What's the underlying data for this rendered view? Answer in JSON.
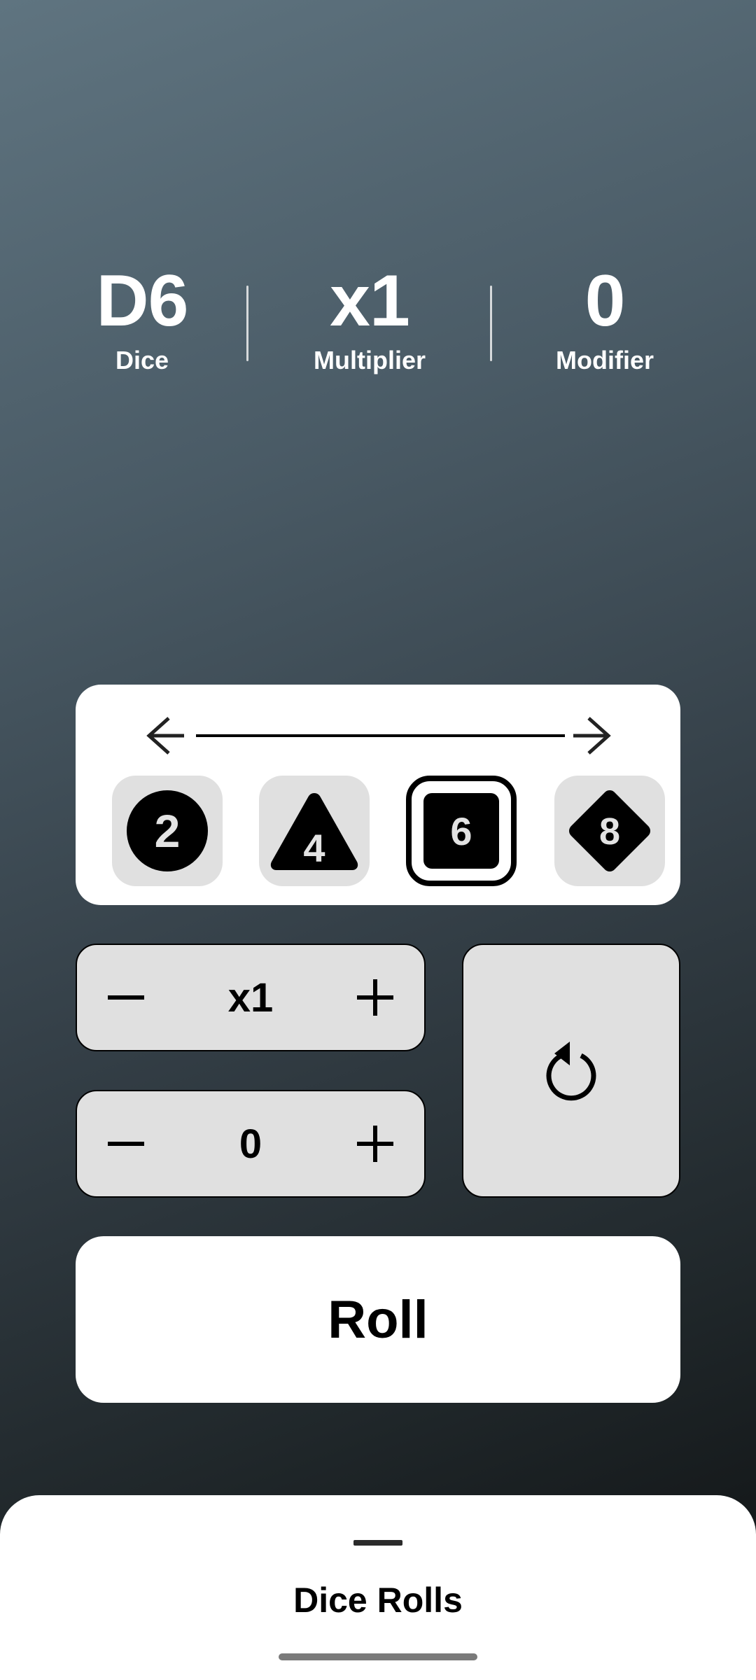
{
  "stats": {
    "dice": {
      "value": "D6",
      "label": "Dice"
    },
    "multiplier": {
      "value": "x1",
      "label": "Multiplier"
    },
    "modifier": {
      "value": "0",
      "label": "Modifier"
    }
  },
  "picker": {
    "dice": [
      {
        "label": "2",
        "shape": "circle",
        "selected": false
      },
      {
        "label": "4",
        "shape": "triangle",
        "selected": false
      },
      {
        "label": "6",
        "shape": "square",
        "selected": true
      },
      {
        "label": "8",
        "shape": "diamond",
        "selected": false
      }
    ]
  },
  "controls": {
    "multiplier_value": "x1",
    "modifier_value": "0",
    "roll_label": "Roll"
  },
  "sheet": {
    "title": "Dice Rolls"
  },
  "colors": {
    "background_top": "#5f7480",
    "background_bottom": "#0e1011",
    "card": "#ffffff",
    "control": "#e0e0e0",
    "die_glyph": "#000000"
  }
}
